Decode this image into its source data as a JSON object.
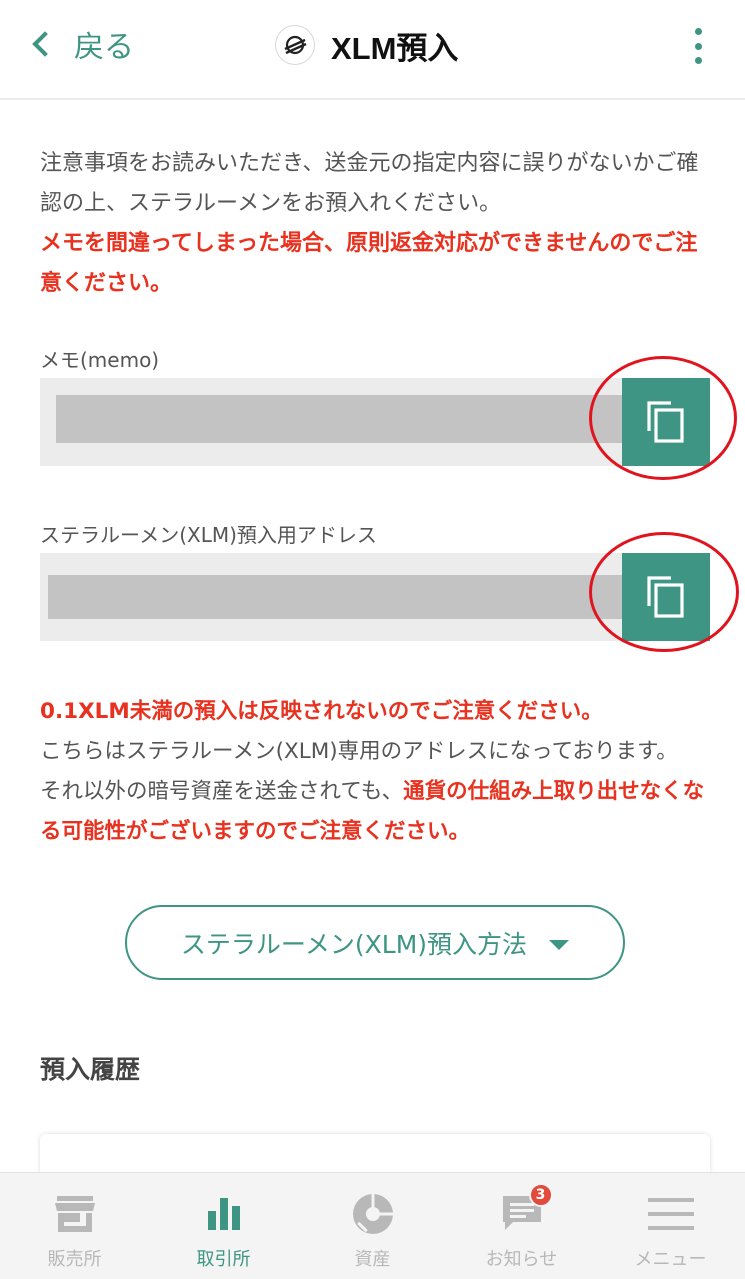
{
  "header": {
    "back_label": "戻る",
    "title": "XLM預入",
    "coin_icon": "stellar-icon",
    "menu_icon": "kebab-menu-icon"
  },
  "intro": {
    "text": "注意事項をお読みいただき、送金元の指定内容に誤りがないかご確認の上、ステラルーメンをお預入れください。",
    "warning": "メモを間違ってしまった場合、原則返金対応ができませんのでご注意ください。"
  },
  "memo": {
    "label": "メモ(memo)",
    "value_masked": true,
    "copy_icon": "copy-icon"
  },
  "address": {
    "label": "ステラルーメン(XLM)預入用アドレス",
    "value_masked": true,
    "copy_icon": "copy-icon"
  },
  "notes": {
    "min_warning": "0.1XLM未満の預入は反映されないのでご注意ください。",
    "line1": "こちらはステラルーメン(XLM)専用のアドレスになっております。",
    "line2_normal": "それ以外の暗号資産を送金されても、",
    "line2_warning": "通貨の仕組み上取り出せなくなる可能性がございますのでご注意ください。"
  },
  "method_button": {
    "label": "ステラルーメン(XLM)預入方法",
    "icon": "triangle-down-icon"
  },
  "history": {
    "title": "預入履歴"
  },
  "tabbar": {
    "items": [
      {
        "label": "販売所",
        "icon": "store-icon",
        "active": false
      },
      {
        "label": "取引所",
        "icon": "bar-chart-icon",
        "active": true
      },
      {
        "label": "資産",
        "icon": "pie-chart-icon",
        "active": false
      },
      {
        "label": "お知らせ",
        "icon": "chat-bubble-icon",
        "active": false,
        "badge": "3"
      },
      {
        "label": "メニュー",
        "icon": "hamburger-menu-icon",
        "active": false
      }
    ]
  },
  "colors": {
    "accent": "#3e9583",
    "warning": "#e8321f",
    "highlight_ring": "#e1141e",
    "masked": "#c3c3c3"
  }
}
